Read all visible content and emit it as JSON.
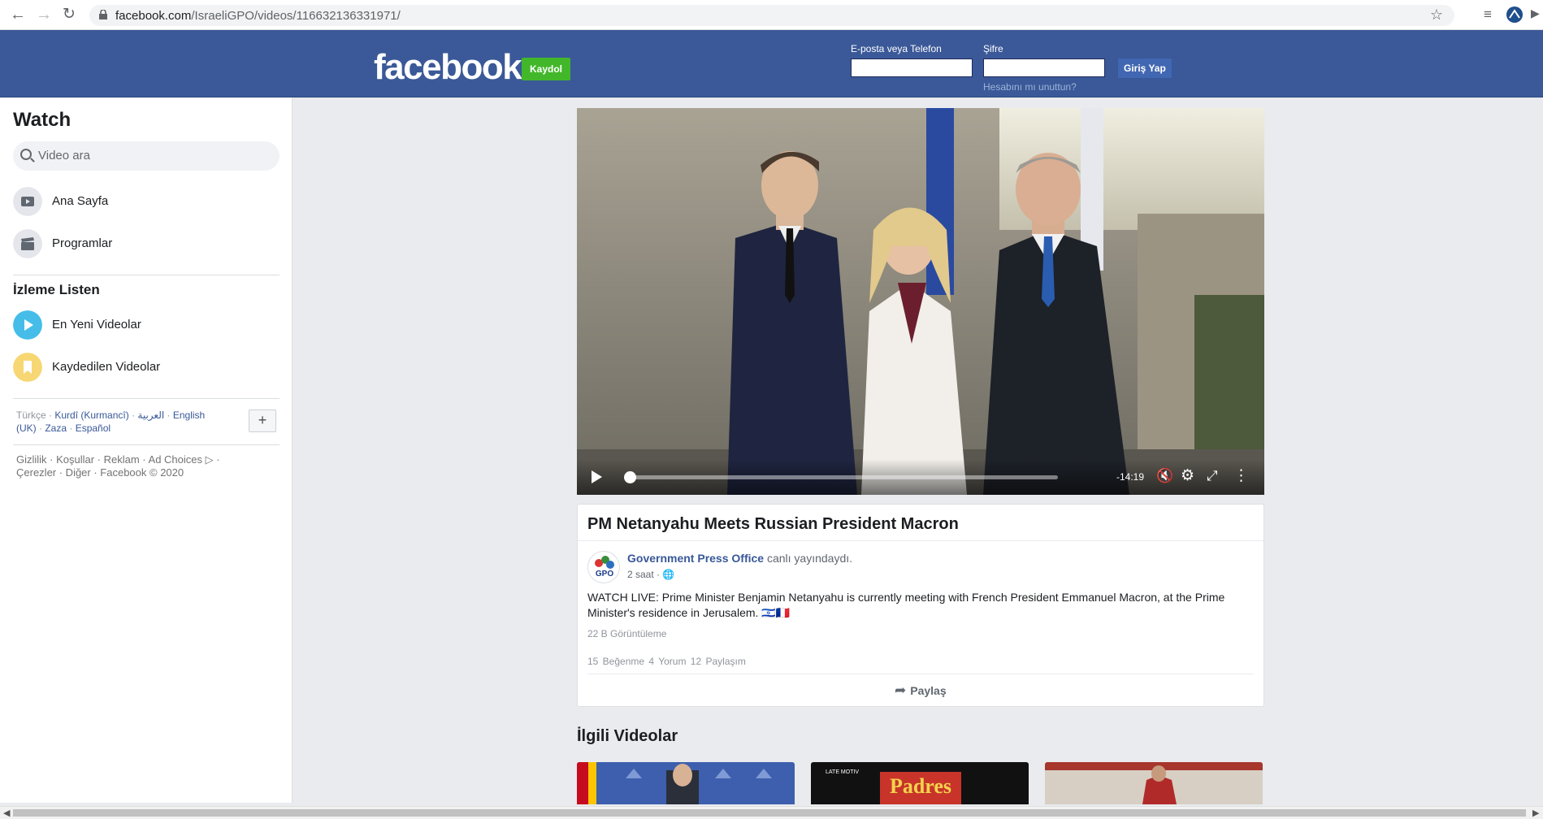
{
  "browser": {
    "url_host": "facebook.com",
    "url_path": "/IsraeliGPO/videos/116632136331971/"
  },
  "header": {
    "logo": "facebook",
    "signup_label": "Kaydol",
    "email_label": "E-posta veya Telefon",
    "password_label": "Şifre",
    "login_label": "Giriş Yap",
    "forgot_label": "Hesabını mı unuttun?"
  },
  "sidebar": {
    "title": "Watch",
    "search_placeholder": "Video ara",
    "items": [
      {
        "label": "Ana Sayfa",
        "icon": "play-box-icon"
      },
      {
        "label": "Programlar",
        "icon": "clapperboard-icon"
      }
    ],
    "watchlist_title": "İzleme Listen",
    "watchlist": [
      {
        "label": "En Yeni Videolar",
        "icon": "play-circle-icon"
      },
      {
        "label": "Kaydedilen Videolar",
        "icon": "bookmark-icon"
      }
    ],
    "languages": {
      "current": "Türkçe",
      "others": [
        "Kurdî (Kurmancî)",
        "العربية",
        "English (UK)",
        "Zaza",
        "Español"
      ]
    },
    "footer": {
      "line1": "Gizlilik · Koşullar · Reklam · Ad Choices ▷ ·",
      "line2": "Çerezler · Diğer · Facebook © 2020"
    }
  },
  "video": {
    "time_remaining": "-14:19",
    "progress": 0.0
  },
  "post": {
    "title": "PM Netanyahu Meets Russian President Macron",
    "page_name": "Government Press Office",
    "action": "canlı yayındaydı.",
    "time": "2 saat",
    "avatar_text": "GPO",
    "description": "WATCH LIVE: Prime Minister Benjamin Netanyahu is currently meeting with French President Emmanuel Macron, at the Prime Minister's residence in Jerusalem. 🇮🇱🇫🇷",
    "views": "22 B Görüntüleme",
    "likes": "15 Beğenme",
    "comments": "4 Yorum",
    "shares": "12 Paylaşım",
    "share_label": "Paylaş"
  },
  "related": {
    "title": "İlgili Videolar",
    "thumb2_text": "Padres",
    "thumb2_tag": "LATE MOTIV"
  },
  "colors": {
    "fb_blue": "#3b5998",
    "signup_green": "#42b72a",
    "link_blue": "#385898"
  }
}
